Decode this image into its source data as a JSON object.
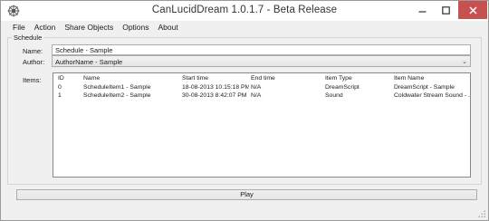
{
  "window": {
    "title": "CanLucidDream 1.0.1.7 - Beta Release",
    "icons": {
      "app": "wheel-icon",
      "minimize": "minimize-icon",
      "maximize": "maximize-icon",
      "close": "close-icon"
    }
  },
  "menu": [
    "File",
    "Action",
    "Share Objects",
    "Options",
    "About"
  ],
  "schedule": {
    "group_label": "Schedule",
    "name_label": "Name:",
    "name_value": "Schedule - Sample",
    "author_label": "Author:",
    "author_value": "AuthorName - Sample",
    "items_label": "Items:"
  },
  "items_table": {
    "columns": [
      "ID",
      "Name",
      "Start time",
      "End time",
      "Item Type",
      "Item Name"
    ],
    "rows": [
      [
        "0",
        "ScheduleItem1 - Sample",
        "18-08-2013 10:15:18 PM",
        "N/A",
        "DreamScript",
        "DreamScript - Sample"
      ],
      [
        "1",
        "ScheduleItem2 - Sample",
        "30-08-2013 8:42:07 PM",
        "N/A",
        "Sound",
        "Coldwater Stream Sound - ..."
      ]
    ]
  },
  "play_label": "Play",
  "colors": {
    "close_button": "#c75050",
    "window_bg": "#f0f0f0"
  }
}
